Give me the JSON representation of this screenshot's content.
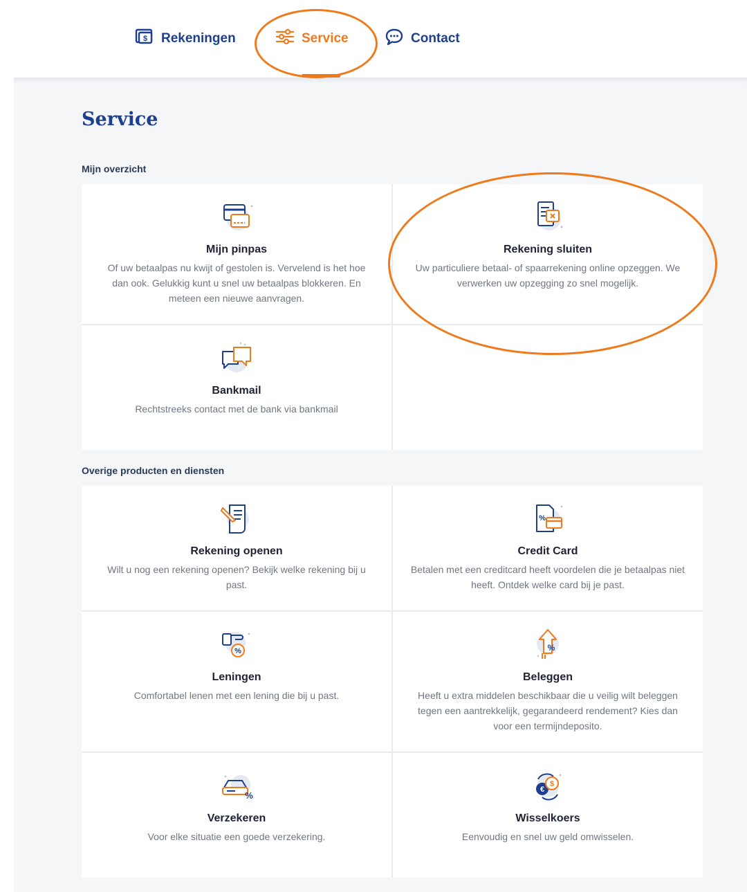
{
  "nav": {
    "items": [
      {
        "label": "Rekeningen",
        "icon": "wallet-icon"
      },
      {
        "label": "Service",
        "icon": "sliders-icon",
        "active": true
      },
      {
        "label": "Contact",
        "icon": "chat-icon"
      }
    ]
  },
  "page": {
    "title": "Service"
  },
  "sections": [
    {
      "label": "Mijn overzicht",
      "cards": [
        {
          "title": "Mijn pinpas",
          "description": "Of uw betaalpas nu kwijt of gestolen is. Vervelend is het hoe dan ook. Gelukkig kunt u snel uw betaalpas blokkeren. En meteen een nieuwe aanvragen.",
          "icon": "debit-card-icon"
        },
        {
          "title": "Rekening sluiten",
          "description": "Uw particuliere betaal- of spaarrekening online opzeggen. We verwerken uw opzegging zo snel mogelijk.",
          "icon": "close-account-icon"
        },
        {
          "title": "Bankmail",
          "description": "Rechtstreeks contact met de bank via bankmail",
          "icon": "chat-bubbles-icon"
        }
      ]
    },
    {
      "label": "Overige producten en diensten",
      "cards": [
        {
          "title": "Rekening openen",
          "description": "Wilt u nog een rekening openen? Bekijk welke rekening bij u past.",
          "icon": "document-sign-icon"
        },
        {
          "title": "Credit Card",
          "description": "Betalen met een creditcard heeft voordelen die je betaalpas niet heeft. Ontdek welke card bij je past.",
          "icon": "credit-card-icon"
        },
        {
          "title": "Leningen",
          "description": "Comfortabel lenen met een lening die bij u past.",
          "icon": "loan-icon"
        },
        {
          "title": "Beleggen",
          "description": "Heeft u extra middelen beschikbaar die u veilig wilt beleggen tegen een aantrekkelijk, gegarandeerd rendement? Kies dan voor een termijndeposito.",
          "icon": "investment-arrow-icon"
        },
        {
          "title": "Verzekeren",
          "description": "Voor elke situatie een goede verzekering.",
          "icon": "car-insurance-icon"
        },
        {
          "title": "Wisselkoers",
          "description": "Eenvoudig en snel uw geld omwisselen.",
          "icon": "currency-exchange-icon"
        }
      ]
    }
  ],
  "colors": {
    "brand_blue": "#1d3f8f",
    "accent_orange": "#ee7a1c",
    "background": "#f4f6f8",
    "text_muted": "#707683"
  }
}
